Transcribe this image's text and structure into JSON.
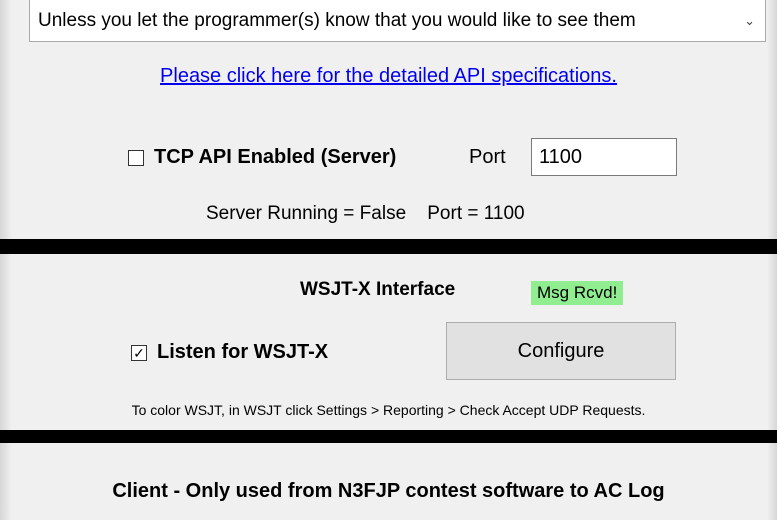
{
  "dropdown": {
    "selected": "Unless you let the programmer(s) know that you would like to see them",
    "chevron": "chevron-down-icon"
  },
  "api_link": "Please click here for the detailed API specifications.",
  "tcp": {
    "checkbox_label": "TCP API Enabled (Server)",
    "checked": false,
    "port_label": "Port",
    "port_value": "1100",
    "status": "Server Running = False    Port = 1100"
  },
  "wsjt": {
    "title": "WSJT-X Interface",
    "badge": "Msg Rcvd!",
    "badge_color": "#90ee90",
    "listen_label": "Listen for WSJT-X",
    "listen_checked": true,
    "configure_label": "Configure",
    "hint": "To color WSJT, in WSJT click Settings > Reporting > Check Accept UDP Requests."
  },
  "client": {
    "title": "Client - Only used from N3FJP contest software to AC Log"
  }
}
